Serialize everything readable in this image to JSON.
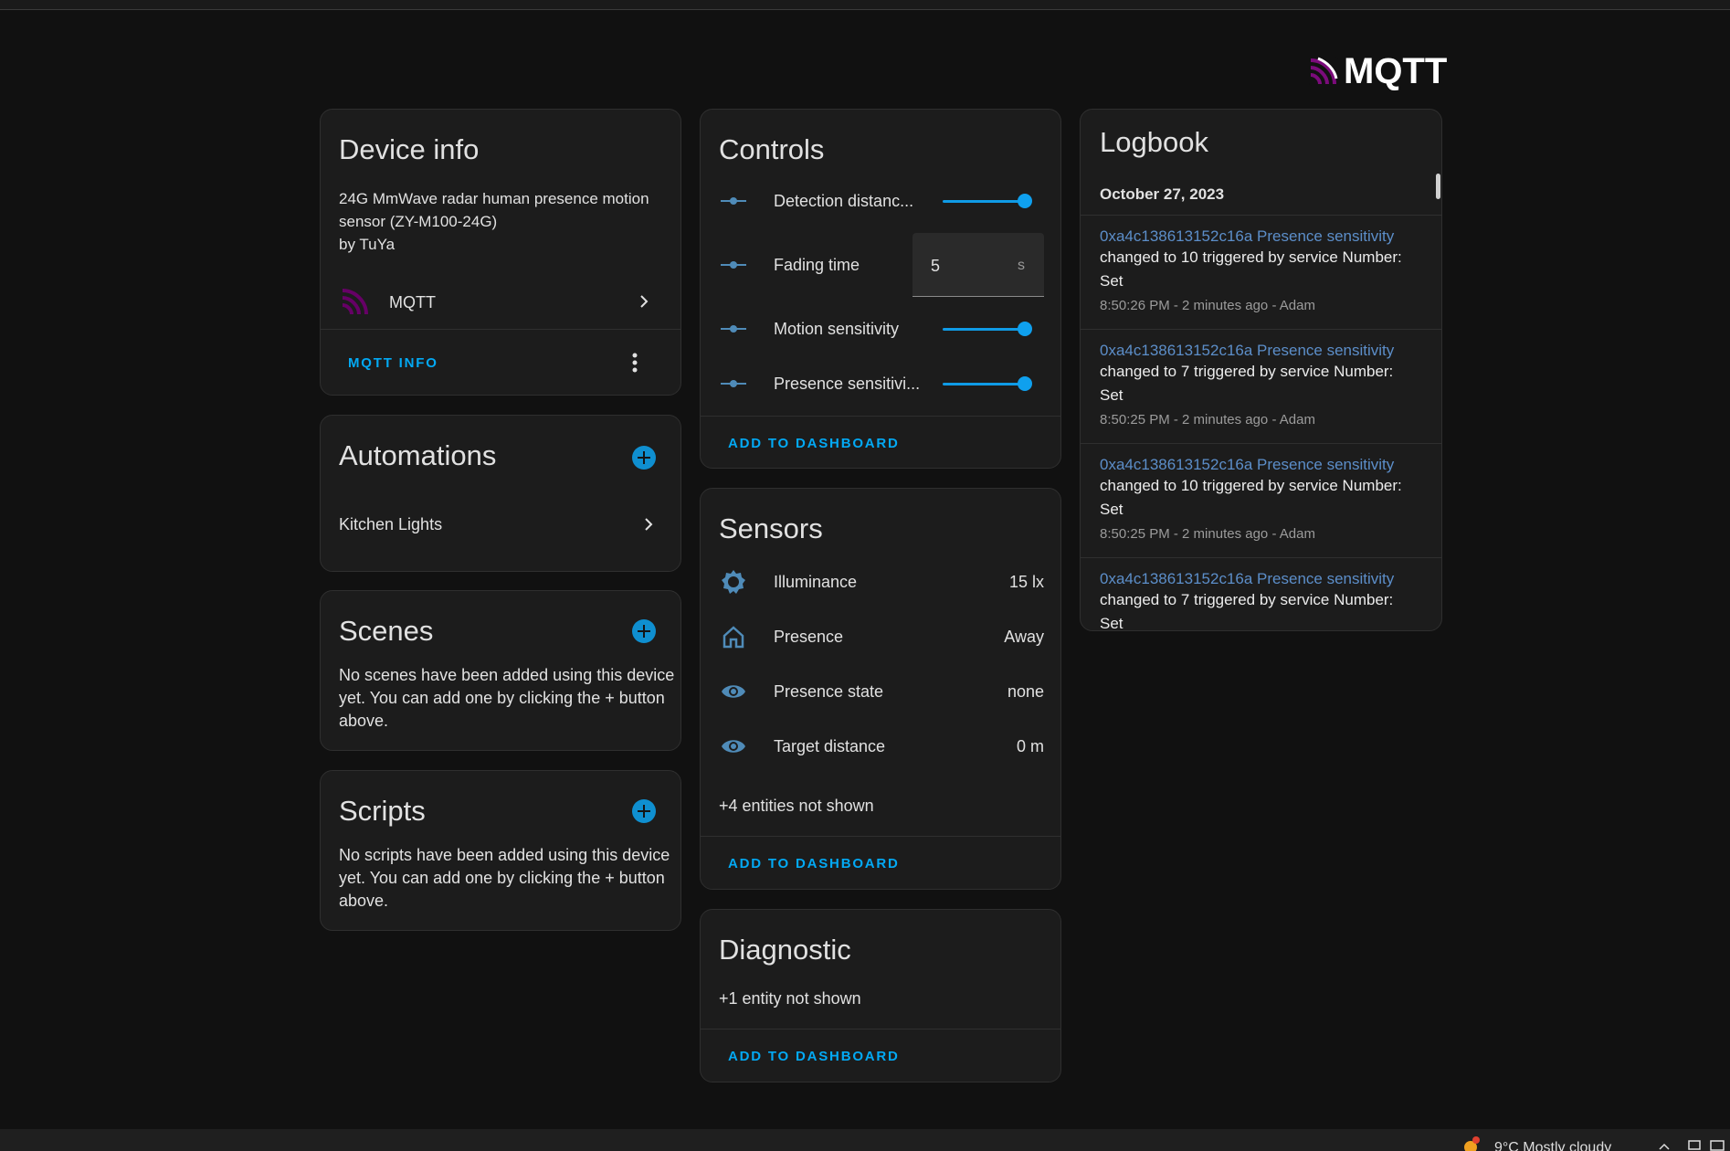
{
  "brand": {
    "name": "MQTT"
  },
  "device_info": {
    "title": "Device info",
    "model_line1": "24G MmWave radar human presence motion",
    "model_line2": "sensor (ZY-M100-24G)",
    "manufacturer": "by TuYa",
    "integration": "MQTT",
    "mqtt_info_button": "MQTT INFO"
  },
  "automations": {
    "title": "Automations",
    "items": [
      {
        "label": "Kitchen Lights"
      }
    ]
  },
  "scenes": {
    "title": "Scenes",
    "empty_line1": "No scenes have been added using this device",
    "empty_line2": "yet. You can add one by clicking the + button",
    "empty_line3": "above."
  },
  "scripts": {
    "title": "Scripts",
    "empty_line1": "No scripts have been added using this device",
    "empty_line2": "yet. You can add one by clicking the + button",
    "empty_line3": "above."
  },
  "controls": {
    "title": "Controls",
    "items": [
      {
        "label": "Detection distanc...",
        "type": "slider",
        "level": 1.0
      },
      {
        "label": "Fading time",
        "type": "number",
        "value": "5",
        "unit": "s"
      },
      {
        "label": "Motion sensitivity",
        "type": "slider",
        "level": 1.0
      },
      {
        "label": "Presence sensitivi...",
        "type": "slider",
        "level": 1.0
      }
    ],
    "add_button": "ADD TO DASHBOARD"
  },
  "sensors": {
    "title": "Sensors",
    "items": [
      {
        "label": "Illuminance",
        "value": "15 lx",
        "icon": "brightness-icon"
      },
      {
        "label": "Presence",
        "value": "Away",
        "icon": "home-outline-icon"
      },
      {
        "label": "Presence state",
        "value": "none",
        "icon": "eye-icon"
      },
      {
        "label": "Target distance",
        "value": "0 m",
        "icon": "eye-icon"
      }
    ],
    "hidden_entities": "+4 entities not shown",
    "add_button": "ADD TO DASHBOARD"
  },
  "diagnostic": {
    "title": "Diagnostic",
    "hidden_entities": "+1 entity not shown",
    "add_button": "ADD TO DASHBOARD"
  },
  "logbook": {
    "title": "Logbook",
    "date": "October 27, 2023",
    "entries": [
      {
        "entity": "0xa4c138613152c16a Presence sensitivity",
        "msg1": "changed to 10 triggered by service Number:",
        "msg2": "Set",
        "meta": "8:50:26 PM - 2 minutes ago - Adam"
      },
      {
        "entity": "0xa4c138613152c16a Presence sensitivity",
        "msg1": "changed to 7 triggered by service Number:",
        "msg2": "Set",
        "meta": "8:50:25 PM - 2 minutes ago - Adam"
      },
      {
        "entity": "0xa4c138613152c16a Presence sensitivity",
        "msg1": "changed to 10 triggered by service Number:",
        "msg2": "Set",
        "meta": "8:50:25 PM - 2 minutes ago - Adam"
      },
      {
        "entity": "0xa4c138613152c16a Presence sensitivity",
        "msg1": "changed to 7 triggered by service Number:",
        "msg2": "Set",
        "meta": ""
      }
    ]
  },
  "taskbar": {
    "weather": "9°C  Mostly cloudy"
  },
  "colors": {
    "accent": "#03a9f4",
    "card_bg": "#1c1c1c",
    "page_bg": "#111111",
    "mqtt_purple": "#660066"
  }
}
